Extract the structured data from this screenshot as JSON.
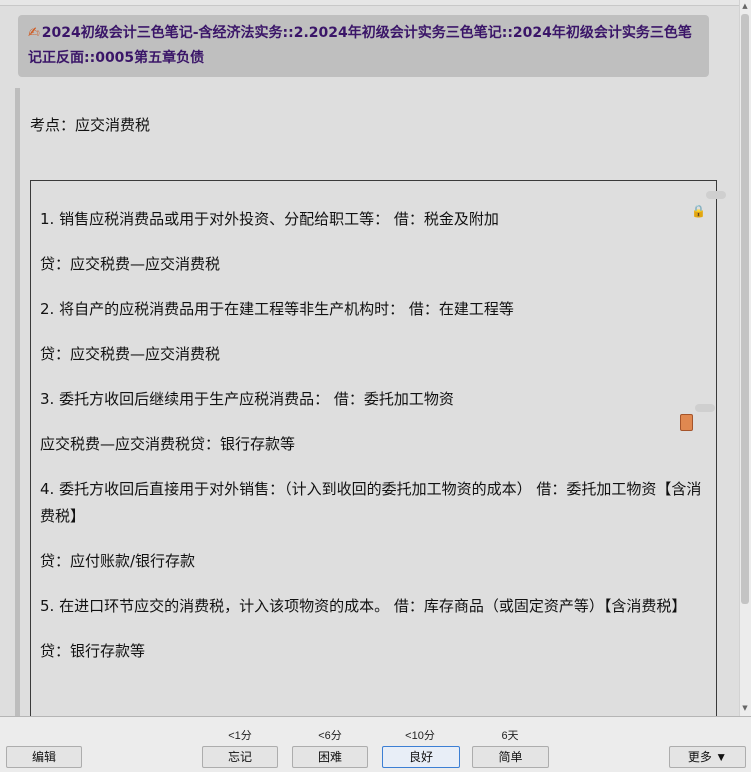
{
  "header": {
    "title": "2024初级会计三色笔记-含经济法实务::2.2024年初级会计实务三色笔记::2024年初级会计实务三色笔记正反面::0005第五章负债"
  },
  "topic": "考点：应交消费税",
  "note": {
    "lines": [
      "1. 销售应税消费品或用于对外投资、分配给职工等：  借：税金及附加",
      "贷：应交税费—应交消费税",
      "2. 将自产的应税消费品用于在建工程等非生产机构时：  借：在建工程等",
      "贷：应交税费—应交消费税",
      "3. 委托方收回后继续用于生产应税消费品：  借：委托加工物资",
      "应交税费—应交消费税贷：银行存款等",
      "4. 委托方收回后直接用于对外销售：（计入到收回的委托加工物资的成本）  借：委托加工物资【含消费税】",
      "贷：应付账款/银行存款",
      "5. 在进口环节应交的消费税，计入该项物资的成本。 借：库存商品（或固定资产等）【含消费税】",
      "贷：银行存款等"
    ]
  },
  "toolbar": {
    "edit_label": "编辑",
    "more_label": "更多 ▼",
    "answers": [
      {
        "label": "忘记",
        "time": "<1分"
      },
      {
        "label": "困难",
        "time": "<6分"
      },
      {
        "label": "良好",
        "time": "<10分"
      },
      {
        "label": "简单",
        "time": "6天"
      }
    ]
  }
}
